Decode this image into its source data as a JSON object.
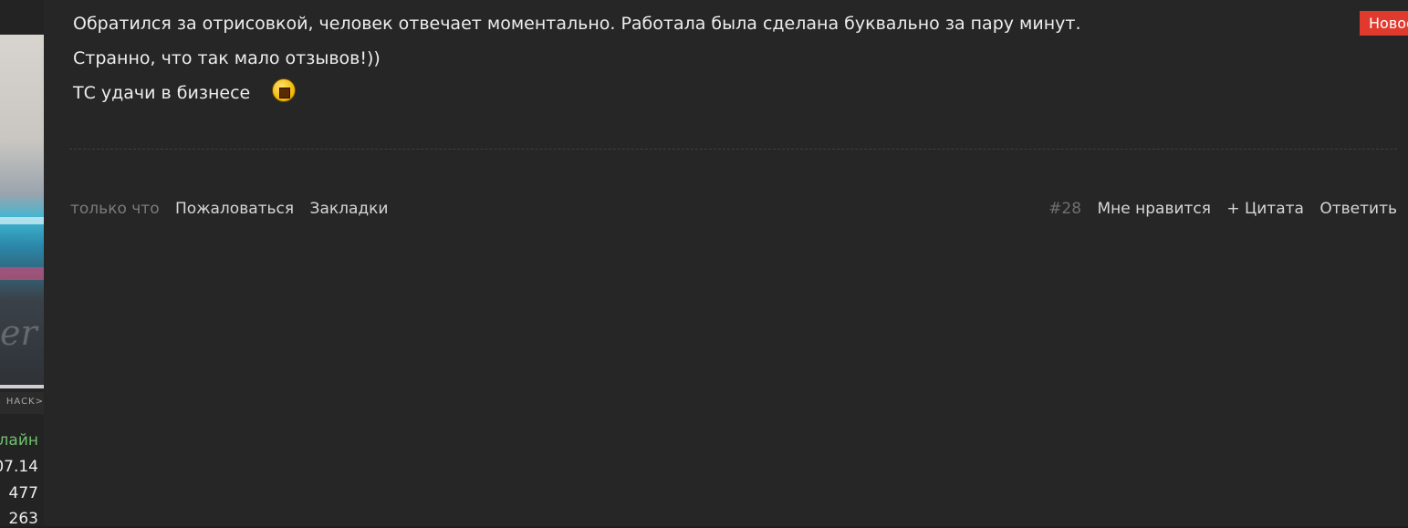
{
  "sidebar": {
    "avatar_caption": "HACK>",
    "status": "лайн",
    "stats": [
      "07.14",
      "477",
      "263"
    ]
  },
  "post": {
    "lines": [
      "Обратился за отрисовкой, человек отвечает моментально. Работала была сделана буквально за пару минут.",
      "Странно, что так мало отзывов!))",
      "ТС удачи в бизнесе"
    ],
    "badge": "Новое",
    "footer": {
      "time": "только что",
      "report": "Пожаловаться",
      "bookmarks": "Закладки",
      "post_number": "#28",
      "like": "Мне нравится",
      "quote": "+ Цитата",
      "reply": "Ответить"
    }
  },
  "colors": {
    "background": "#262626",
    "badge": "#e03a2e",
    "status_online": "#6ec16e"
  },
  "icons": {
    "smiley": "money-mouth-smiley-icon"
  }
}
